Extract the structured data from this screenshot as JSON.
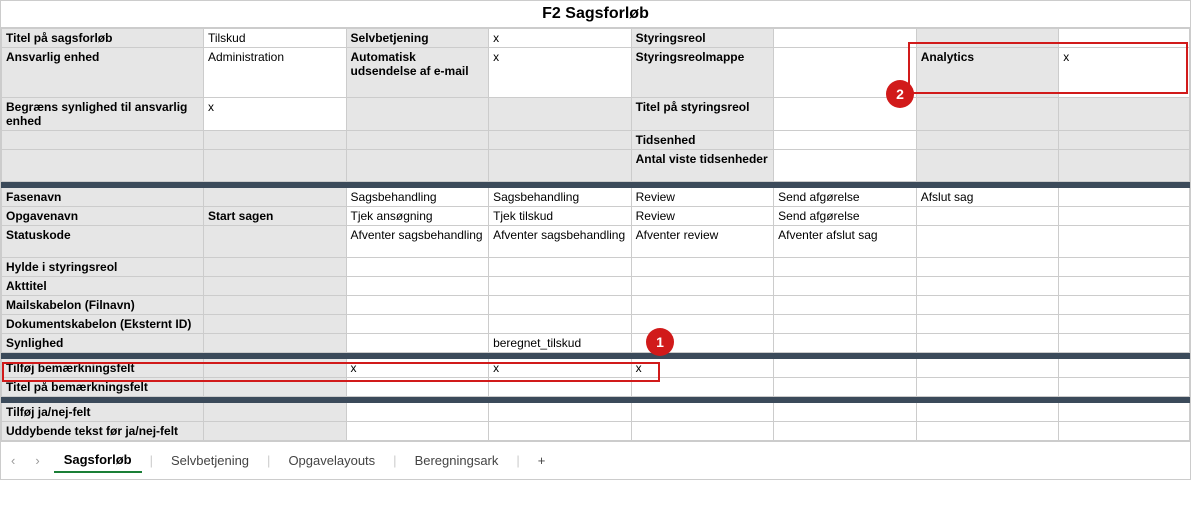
{
  "title": "F2 Sagsforløb",
  "tabs": {
    "active": "Sagsforløb",
    "items": [
      "Sagsforløb",
      "Selvbetjening",
      "Opgavelayouts",
      "Beregningsark"
    ]
  },
  "block1": {
    "r1": {
      "a": "Titel på sagsforløb",
      "b": "Tilskud",
      "c": "Selvbetjening",
      "d": "x",
      "e": "Styringsreol",
      "f": "",
      "g": "",
      "h": ""
    },
    "r2": {
      "a": "Ansvarlig enhed",
      "b": "Administration",
      "c": "Automatisk udsendelse af e-mail",
      "d": "x",
      "e": "Styringsreolmappe",
      "f": "",
      "g": "Analytics",
      "h": "x"
    },
    "r3": {
      "a": "Begræns synlighed til ansvarlig enhed",
      "b": "x",
      "c": "",
      "d": "",
      "e": "Titel på styringsreol",
      "f": "",
      "g": "",
      "h": ""
    },
    "r4": {
      "e": "Tidsenhed"
    },
    "r5": {
      "e": "Antal viste tidsenheder"
    }
  },
  "block2": {
    "fasenavn": {
      "a": "Fasenavn",
      "b": "",
      "c": "Sagsbehandling",
      "d": "Sagsbehandling",
      "e": "Review",
      "f": "Send afgørelse",
      "g": "Afslut sag",
      "h": ""
    },
    "opgavenavn": {
      "a": "Opgavenavn",
      "b": "Start sagen",
      "c": "Tjek ansøgning",
      "d": "Tjek tilskud",
      "e": "Review",
      "f": "Send afgørelse",
      "g": "",
      "h": ""
    },
    "statuskode": {
      "a": "Statuskode",
      "b": "",
      "c": "Afventer sagsbehandling",
      "d": "Afventer sagsbehandling",
      "e": "Afventer review",
      "f": "Afventer afslut sag",
      "g": "",
      "h": ""
    },
    "hylde": {
      "a": "Hylde i styringsreol"
    },
    "akttitel": {
      "a": "Akttitel"
    },
    "mail": {
      "a": "Mailskabelon (Filnavn)"
    },
    "dok": {
      "a": "Dokumentskabelon (Eksternt ID)"
    },
    "synlighed": {
      "a": "Synlighed",
      "b": "",
      "c": "",
      "d": "beregnet_tilskud",
      "e": "",
      "f": "",
      "g": "",
      "h": ""
    }
  },
  "block3": {
    "r1": {
      "a": "Tilføj bemærkningsfelt",
      "b": "",
      "c": "x",
      "d": "x",
      "e": "x",
      "f": "",
      "g": "",
      "h": ""
    },
    "r2": {
      "a": "Titel på bemærkningsfelt"
    }
  },
  "block4": {
    "r1": {
      "a": "Tilføj ja/nej-felt"
    },
    "r2": {
      "a": "Uddybende tekst før ja/nej-felt"
    }
  },
  "callouts": {
    "one": "1",
    "two": "2"
  }
}
